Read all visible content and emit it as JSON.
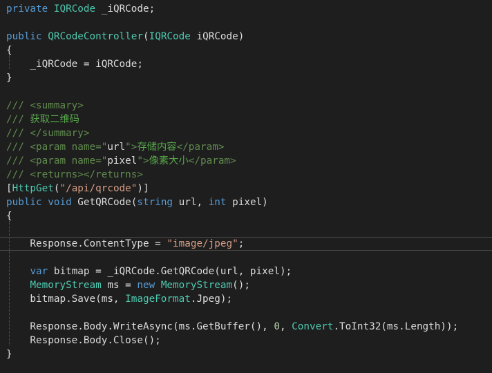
{
  "colors": {
    "background": "#1e1e1e",
    "default_text": "#dcdcdc",
    "keyword": "#569cd6",
    "type": "#4ec9b0",
    "string": "#d69d85",
    "comment": "#57a64a",
    "xml_doc_tag": "#608b4e",
    "number": "#b5cea8",
    "current_line_border": "#464646"
  },
  "code": {
    "lines": [
      [
        [
          "kw",
          "private"
        ],
        [
          "df",
          " "
        ],
        [
          "ty",
          "IQRCode"
        ],
        [
          "df",
          " _iQRCode;"
        ]
      ],
      [],
      [
        [
          "kw",
          "public"
        ],
        [
          "df",
          " "
        ],
        [
          "ty",
          "QRCodeController"
        ],
        [
          "df",
          "("
        ],
        [
          "ty",
          "IQRCode"
        ],
        [
          "df",
          " iQRCode)"
        ]
      ],
      [
        [
          "df",
          "{"
        ]
      ],
      [
        [
          "df",
          "    _iQRCode = iQRCode;"
        ]
      ],
      [
        [
          "df",
          "}"
        ]
      ],
      [],
      [
        [
          "xd",
          "/// <summary>"
        ]
      ],
      [
        [
          "xd",
          "/// "
        ],
        [
          "cm",
          "获取二维码"
        ]
      ],
      [
        [
          "xd",
          "/// </summary>"
        ]
      ],
      [
        [
          "xd",
          "/// <param name=\""
        ],
        [
          "df",
          "url"
        ],
        [
          "xd",
          "\">"
        ],
        [
          "cm",
          "存储内容"
        ],
        [
          "xd",
          "</param>"
        ]
      ],
      [
        [
          "xd",
          "/// <param name=\""
        ],
        [
          "df",
          "pixel"
        ],
        [
          "xd",
          "\">"
        ],
        [
          "cm",
          "像素大小"
        ],
        [
          "xd",
          "</param>"
        ]
      ],
      [
        [
          "xd",
          "/// <returns></returns>"
        ]
      ],
      [
        [
          "df",
          "["
        ],
        [
          "ty",
          "HttpGet"
        ],
        [
          "df",
          "("
        ],
        [
          "st",
          "\"/api/qrcode\""
        ],
        [
          "df",
          ")]"
        ]
      ],
      [
        [
          "kw",
          "public"
        ],
        [
          "df",
          " "
        ],
        [
          "kw",
          "void"
        ],
        [
          "df",
          " GetQRCode("
        ],
        [
          "kw",
          "string"
        ],
        [
          "df",
          " url, "
        ],
        [
          "kw",
          "int"
        ],
        [
          "df",
          " pixel)"
        ]
      ],
      [
        [
          "df",
          "{"
        ]
      ],
      [],
      [
        [
          "df",
          "    Response.ContentType = "
        ],
        [
          "st",
          "\"image/jpeg\""
        ],
        [
          "df",
          ";"
        ]
      ],
      [],
      [
        [
          "df",
          "    "
        ],
        [
          "kw",
          "var"
        ],
        [
          "df",
          " bitmap = _iQRCode.GetQRCode(url, pixel);"
        ]
      ],
      [
        [
          "df",
          "    "
        ],
        [
          "ty",
          "MemoryStream"
        ],
        [
          "df",
          " ms = "
        ],
        [
          "kw",
          "new"
        ],
        [
          "df",
          " "
        ],
        [
          "ty",
          "MemoryStream"
        ],
        [
          "df",
          "();"
        ]
      ],
      [
        [
          "df",
          "    bitmap.Save(ms, "
        ],
        [
          "ty",
          "ImageFormat"
        ],
        [
          "df",
          ".Jpeg);"
        ]
      ],
      [],
      [
        [
          "df",
          "    Response.Body.WriteAsync(ms.GetBuffer(), "
        ],
        [
          "nm",
          "0"
        ],
        [
          "df",
          ", "
        ],
        [
          "ty",
          "Convert"
        ],
        [
          "df",
          ".ToInt32(ms.Length));"
        ]
      ],
      [
        [
          "df",
          "    Response.Body.Close();"
        ]
      ],
      [
        [
          "df",
          "}"
        ]
      ]
    ],
    "current_line": 17
  }
}
